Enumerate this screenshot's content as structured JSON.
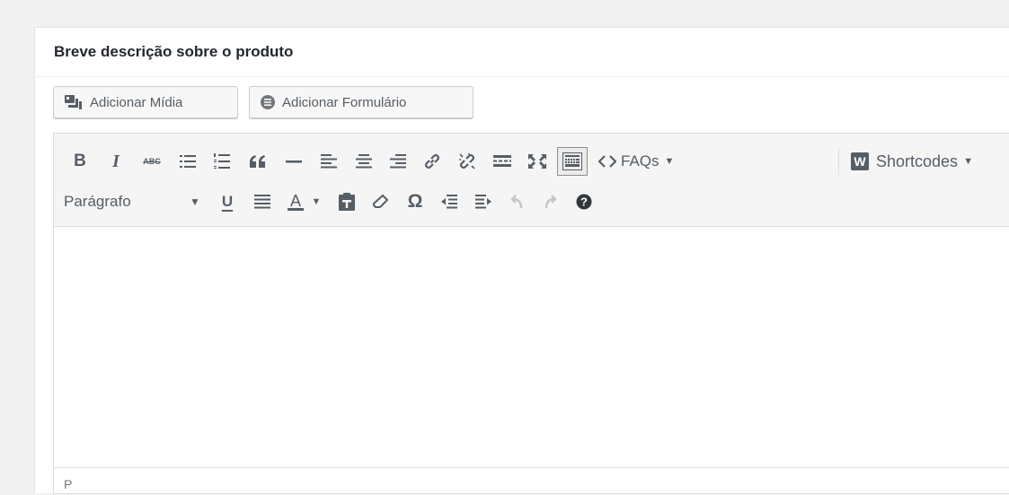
{
  "metabox": {
    "title": "Breve descrição sobre o produto"
  },
  "media_buttons": {
    "add_media": "Adicionar Mídia",
    "add_form": "Adicionar Formulário"
  },
  "toolbar": {
    "row1": {
      "bold": "B",
      "italic": "I",
      "strikethrough": "ABC",
      "faqs_label": "FAQs",
      "shortcodes_badge": "W",
      "shortcodes_label": "Shortcodes"
    },
    "row2": {
      "format_select": "Parágrafo",
      "underline": "U",
      "text_color": "A",
      "special_char": "Ω"
    },
    "icons": {
      "unordered_list": "bullet-list-icon",
      "ordered_list": "numbered-list-icon",
      "blockquote": "quote-icon",
      "hr": "horizontal-line-icon",
      "align_left": "align-left-icon",
      "align_center": "align-center-icon",
      "align_right": "align-right-icon",
      "link": "link-icon",
      "unlink": "unlink-icon",
      "read_more": "read-more-icon",
      "fullscreen": "fullscreen-icon",
      "kitchen_sink": "keyboard-icon",
      "justify": "align-justify-icon",
      "paste_text": "paste-icon",
      "clear_format": "eraser-icon",
      "outdent": "outdent-icon",
      "indent": "indent-icon",
      "undo": "undo-icon",
      "redo": "redo-icon",
      "help": "help-icon"
    },
    "brand_color": "#23282d",
    "icon_color": "#555d66",
    "disabled_color": "#c4c6c9"
  },
  "statusbar": {
    "path": "P"
  }
}
